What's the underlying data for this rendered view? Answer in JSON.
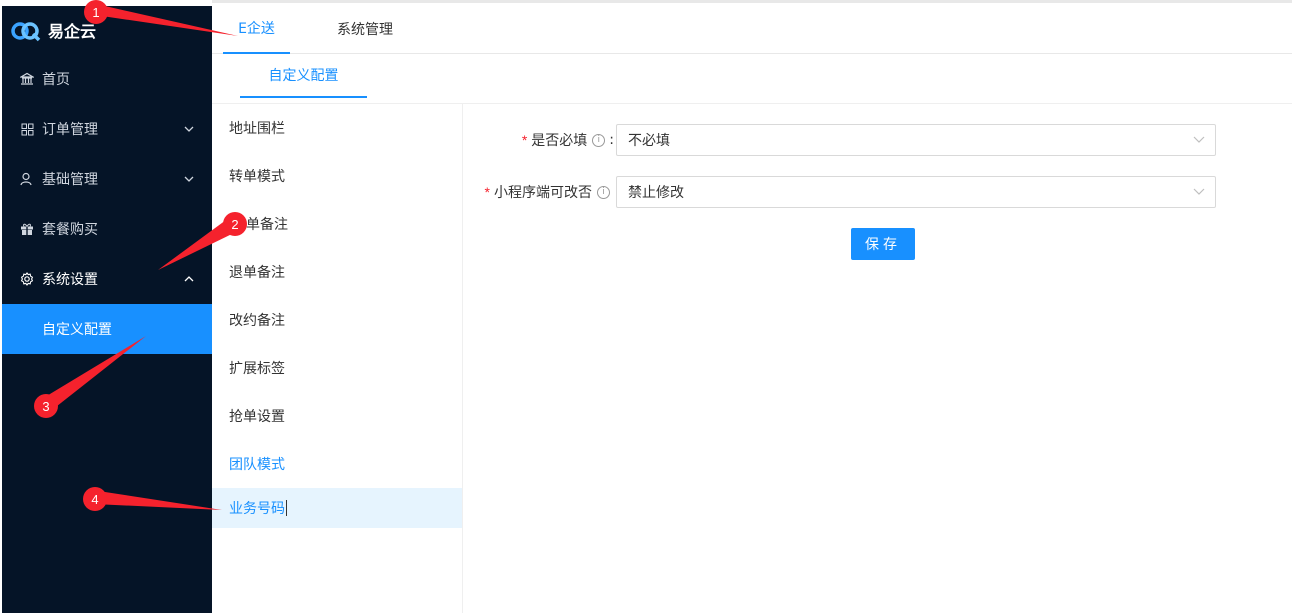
{
  "brand": {
    "name": "易企云",
    "logo_icon": "cq-logo-icon"
  },
  "sidebar": {
    "items": [
      {
        "label": "首页",
        "icon": "bank-icon"
      },
      {
        "label": "订单管理",
        "icon": "grid-icon"
      },
      {
        "label": "基础管理",
        "icon": "user-icon"
      },
      {
        "label": "套餐购买",
        "icon": "gift-icon"
      },
      {
        "label": "系统设置",
        "icon": "gear-icon"
      }
    ],
    "submenu": {
      "label": "自定义配置"
    }
  },
  "top_tabs": [
    {
      "label": "E企送"
    },
    {
      "label": "系统管理"
    }
  ],
  "sub_tab": {
    "label": "自定义配置"
  },
  "config_list": [
    {
      "label": "地址围栏"
    },
    {
      "label": "转单模式"
    },
    {
      "label": "单备注"
    },
    {
      "label": "退单备注"
    },
    {
      "label": "改约备注"
    },
    {
      "label": "扩展标签"
    },
    {
      "label": "抢单设置"
    },
    {
      "label": "团队模式"
    },
    {
      "label": "业务号码"
    }
  ],
  "form": {
    "required_mark": "*",
    "fields": [
      {
        "label": "是否必填",
        "colon": ":",
        "value": "不必填"
      },
      {
        "label": "小程序端可改否",
        "value": "禁止修改"
      }
    ],
    "save_label": "保存"
  },
  "annotations": [
    "1",
    "2",
    "3",
    "4"
  ],
  "colors": {
    "accent": "#1890ff",
    "sidebar_bg": "#051427",
    "annotation": "#f5222d"
  }
}
